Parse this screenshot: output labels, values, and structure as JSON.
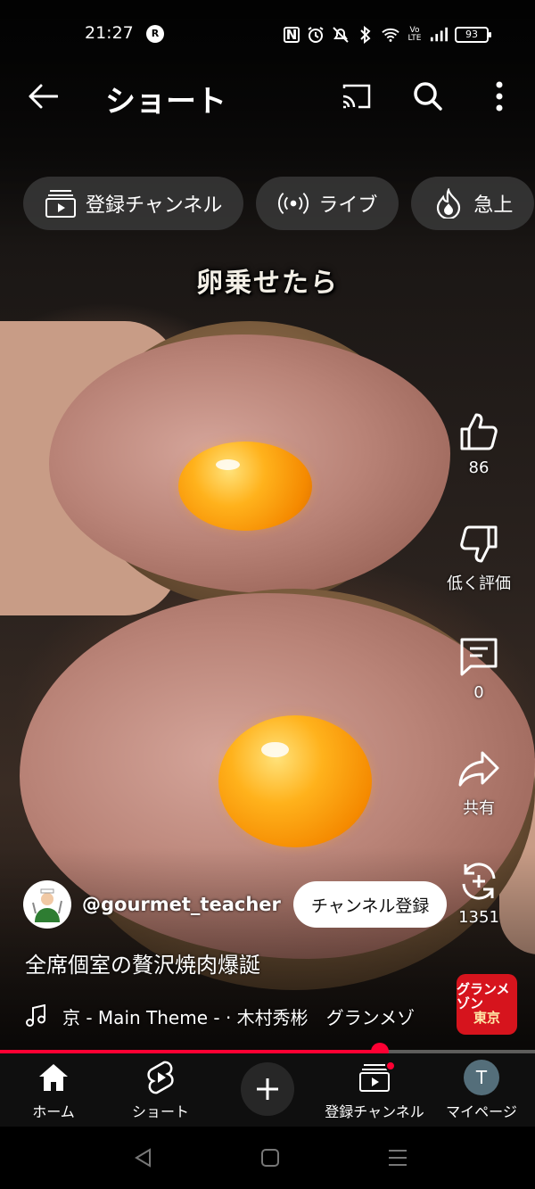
{
  "status_bar": {
    "time": "21:27",
    "r_badge": "R",
    "nfc": "N",
    "volte": "Vo LTE",
    "battery": "93"
  },
  "header": {
    "title": "ショート"
  },
  "chips": [
    {
      "label": "登録チャンネル",
      "icon": "subscriptions-icon"
    },
    {
      "label": "ライブ",
      "icon": "live-icon"
    },
    {
      "label": "急上",
      "icon": "trending-icon"
    }
  ],
  "video": {
    "overlay_caption": "卵乗せたら"
  },
  "actions": {
    "like_count": "86",
    "dislike_label": "低く評価",
    "comment_count": "0",
    "share_label": "共有",
    "remix_count": "1351"
  },
  "channel": {
    "handle": "@gourmet_teacher",
    "subscribe_label": "チャンネル登録"
  },
  "short_title": "全席個室の贅沢焼肉爆誕",
  "music": {
    "text": "京 - Main Theme - · 木村秀彬　グランメゾ",
    "thumb_line1": "グランメゾン",
    "thumb_line2": "東京"
  },
  "progress": {
    "fraction": 0.71
  },
  "bottom_nav": {
    "home": "ホーム",
    "shorts": "ショート",
    "subscriptions": "登録チャンネル",
    "you": "マイページ",
    "avatar_letter": "T"
  },
  "colors": {
    "accent": "#ff0033",
    "chip_bg": "#3c3c3c",
    "nav_bg": "#0f0f0f"
  }
}
